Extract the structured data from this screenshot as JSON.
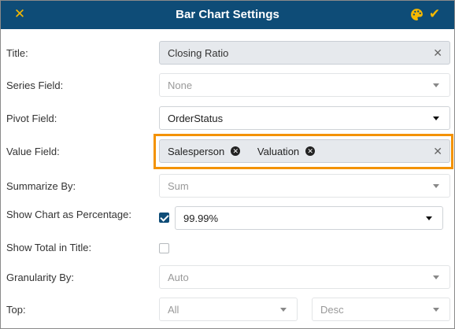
{
  "header": {
    "title": "Bar Chart Settings",
    "close_icon": "×",
    "palette_icon": "palette",
    "confirm_icon": "check"
  },
  "accent_colors": {
    "header_bg": "#0e4c77",
    "header_icons": "#f5b800",
    "highlight": "#f39200"
  },
  "fields": {
    "title": {
      "label": "Title:",
      "value": "Closing Ratio"
    },
    "series": {
      "label": "Series Field:",
      "value": "None"
    },
    "pivot": {
      "label": "Pivot Field:",
      "value": "OrderStatus"
    },
    "value": {
      "label": "Value Field:",
      "tags": [
        "Salesperson",
        "Valuation"
      ]
    },
    "summarize": {
      "label": "Summarize By:",
      "value": "Sum"
    },
    "percentage": {
      "label": "Show Chart as Percentage:",
      "checked": true,
      "format": "99.99%"
    },
    "total": {
      "label": "Show Total in Title:",
      "checked": false
    },
    "granularity": {
      "label": "Granularity By:",
      "value": "Auto"
    },
    "top": {
      "label": "Top:",
      "value": "All",
      "order": "Desc"
    }
  }
}
